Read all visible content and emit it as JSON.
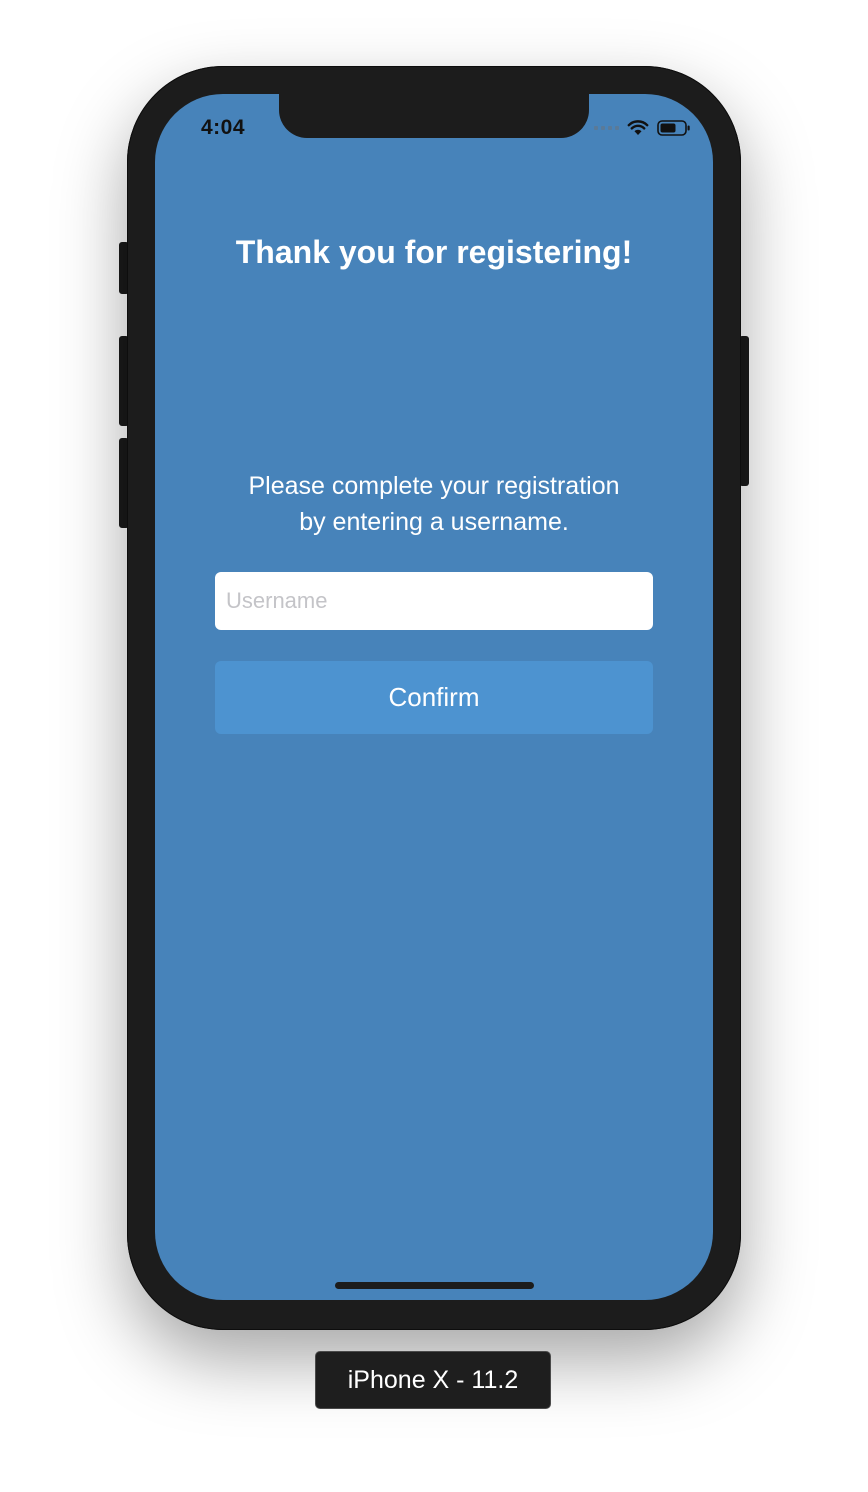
{
  "status_bar": {
    "time": "4:04",
    "icons": [
      "signal-dots-icon",
      "wifi-icon",
      "battery-icon"
    ]
  },
  "screen": {
    "title": "Thank you for registering!",
    "instructions": "Please complete your registration\nby entering a username.",
    "username_field": {
      "placeholder": "Username",
      "value": ""
    },
    "confirm_label": "Confirm"
  },
  "device_label": "iPhone X - 11.2",
  "colors": {
    "screen_background": "#4783ba",
    "button_background": "#4d93d0",
    "phone_frame": "#1c1c1c"
  }
}
